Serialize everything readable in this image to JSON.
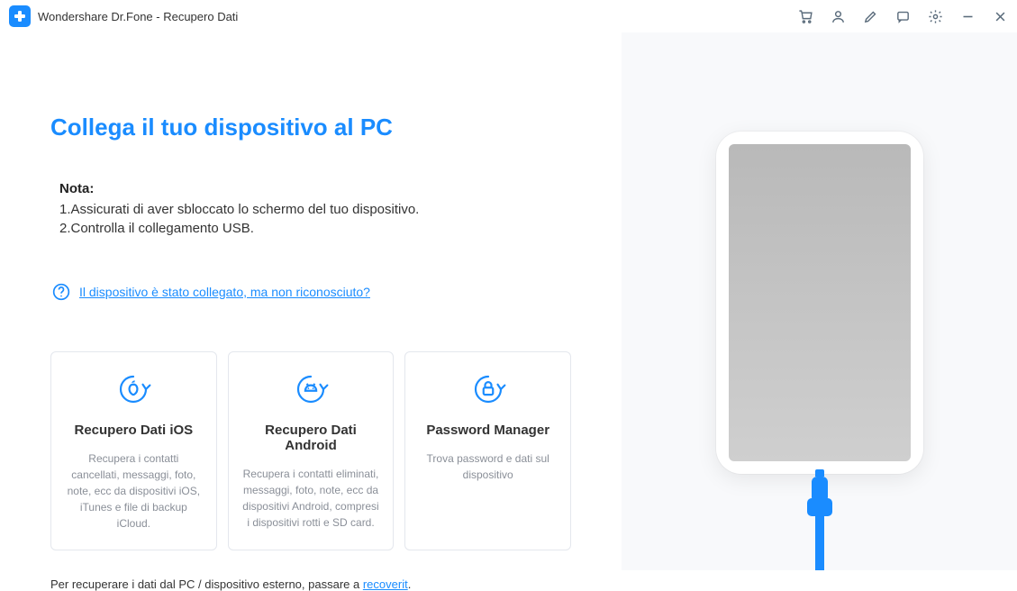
{
  "titlebar": {
    "app_title": "Wondershare Dr.Fone - Recupero Dati"
  },
  "main": {
    "headline": "Collega il tuo dispositivo al PC",
    "note_title": "Nota:",
    "note_items": [
      "1.Assicurati di aver sbloccato lo schermo del tuo dispositivo.",
      "2.Controlla il collegamento USB."
    ],
    "help_link": "Il dispositivo è stato collegato, ma  non riconosciuto?"
  },
  "cards": [
    {
      "title": "Recupero Dati iOS",
      "desc": "Recupera i contatti cancellati, messaggi, foto, note, ecc da dispositivi iOS, iTunes e file di backup iCloud."
    },
    {
      "title": "Recupero Dati Android",
      "desc": "Recupera i contatti eliminati, messaggi, foto, note, ecc da dispositivi Android, compresi i dispositivi rotti e SD card."
    },
    {
      "title": "Password Manager",
      "desc": "Trova password e dati sul dispositivo"
    }
  ],
  "footer": {
    "prefix": "Per recuperare i dati dal PC / dispositivo esterno, passare a ",
    "link": "recoverit",
    "suffix": "."
  }
}
